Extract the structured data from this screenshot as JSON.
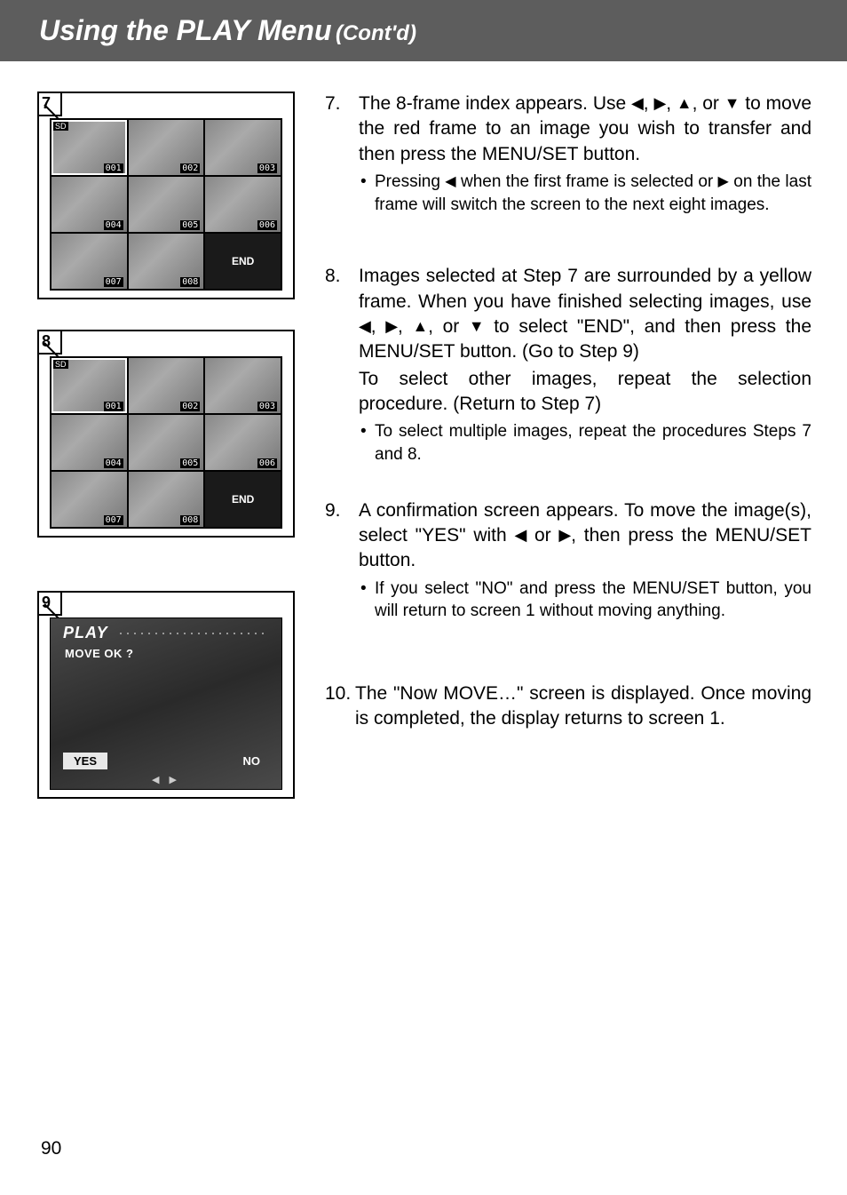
{
  "header": {
    "title_main": "Using the PLAY Menu",
    "title_sub": "(Cont'd)"
  },
  "figures": {
    "f7": {
      "num": "7",
      "thumbs": [
        "001",
        "002",
        "003",
        "004",
        "005",
        "006",
        "007",
        "008"
      ],
      "end": "END"
    },
    "f8": {
      "num": "8",
      "thumbs": [
        "001",
        "002",
        "003",
        "004",
        "005",
        "006",
        "007",
        "008"
      ],
      "end": "END"
    },
    "f9": {
      "num": "9",
      "title": "PLAY",
      "prompt": "MOVE OK ?",
      "yes": "YES",
      "no": "NO"
    }
  },
  "steps": {
    "s7": {
      "num": "7.",
      "text_a": "The 8-frame index appears. Use ",
      "text_b": ", or ",
      "text_c": " to move the red frame to an image you wish to transfer and then press the MENU/SET button.",
      "bullet_a": "Pressing ",
      "bullet_b": " when the first frame is selected or ",
      "bullet_c": " on the last frame will switch the screen to the next eight images."
    },
    "s8": {
      "num": "8.",
      "text_a": "Images selected at Step 7 are surrounded by a yellow frame. When you have finished selecting images, use ",
      "text_b": ", or ",
      "text_c": " to select \"END\", and then press the MENU/SET button. (Go to Step 9)",
      "text_d": "To select other images, repeat the selection procedure. (Return to Step 7)",
      "bullet": "To select multiple images, repeat the procedures Steps 7 and 8."
    },
    "s9": {
      "num": "9.",
      "text_a": "A confirmation screen appears. To move the image(s), select \"YES\" with ",
      "text_b": " or ",
      "text_c": ", then press the MENU/SET button.",
      "bullet": "If you select \"NO\" and press the MENU/SET button, you will return to screen 1 without moving anything."
    },
    "s10": {
      "num": "10.",
      "text": "The \"Now MOVE…\" screen is displayed. Once moving is completed, the display returns to screen 1."
    }
  },
  "arrows": {
    "left": "◀",
    "right": "▶",
    "up": "▲",
    "down": "▼"
  },
  "page_number": "90"
}
